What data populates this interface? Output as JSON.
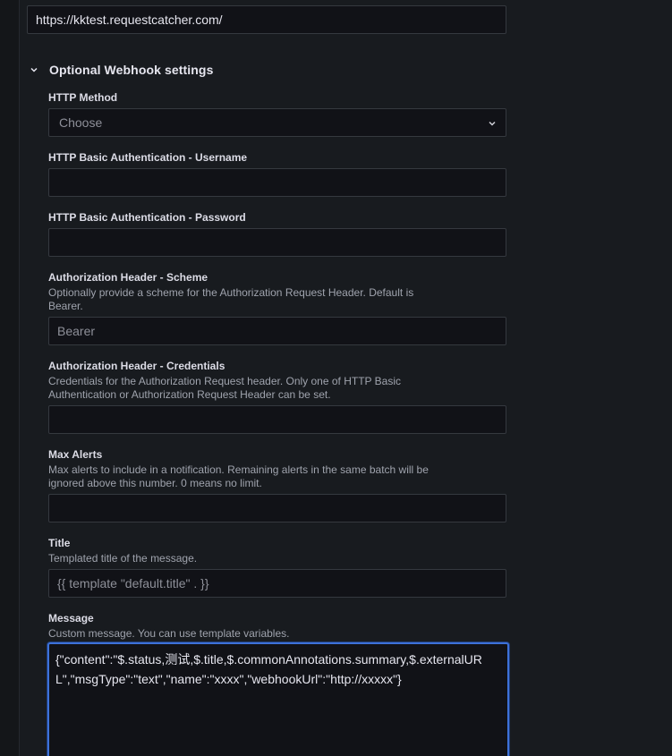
{
  "webhook": {
    "url_value": "https://kktest.requestcatcher.com/"
  },
  "optional_settings": {
    "section_title": "Optional Webhook settings",
    "http_method": {
      "label": "HTTP Method",
      "placeholder": "Choose"
    },
    "basic_auth_username": {
      "label": "HTTP Basic Authentication - Username",
      "value": ""
    },
    "basic_auth_password": {
      "label": "HTTP Basic Authentication - Password",
      "value": ""
    },
    "auth_scheme": {
      "label": "Authorization Header - Scheme",
      "description_line1": "Optionally provide a scheme for the Authorization Request Header. Default is",
      "description_line2": "Bearer.",
      "placeholder": "Bearer"
    },
    "auth_credentials": {
      "label": "Authorization Header - Credentials",
      "description_line1": "Credentials for the Authorization Request header. Only one of HTTP Basic",
      "description_line2": "Authentication or Authorization Request Header can be set.",
      "value": ""
    },
    "max_alerts": {
      "label": "Max Alerts",
      "description_line1": "Max alerts to include in a notification. Remaining alerts in the same batch will be",
      "description_line2": "ignored above this number. 0 means no limit.",
      "value": ""
    },
    "title": {
      "label": "Title",
      "description": "Templated title of the message.",
      "placeholder": "{{ template \"default.title\" . }}"
    },
    "message": {
      "label": "Message",
      "description": "Custom message. You can use template variables.",
      "value": "{\"content\":\"$.status,测试,$.title,$.commonAnnotations.summary,$.externalURL\",\"msgType\":\"text\",\"name\":\"xxxx\",\"webhookUrl\":\"http://xxxxx\"}"
    }
  },
  "icons": {
    "section_toggle": "chevron-down-icon",
    "select_caret": "chevron-down-icon"
  },
  "colors": {
    "background": "#181b1f",
    "input_background": "#111217",
    "input_border": "#35393f",
    "focus_border": "#3d71d9",
    "text_primary": "#e6e6ef",
    "text_secondary": "#9fa3ad"
  }
}
